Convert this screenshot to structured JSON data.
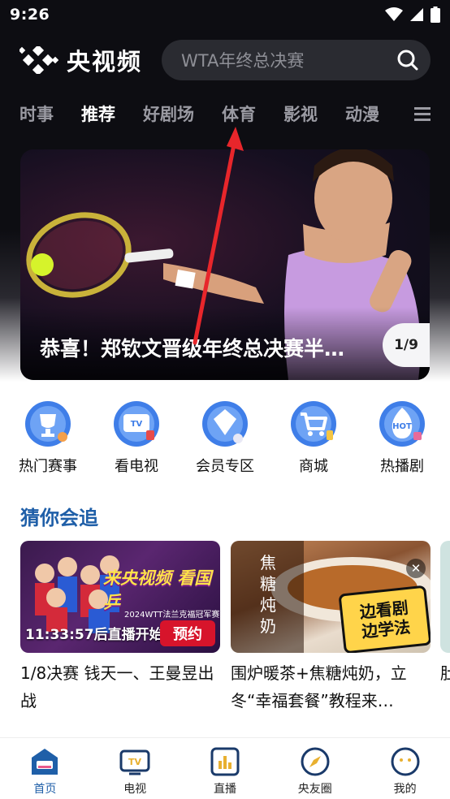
{
  "status_bar": {
    "time": "9:26"
  },
  "header": {
    "app_name": "央视频",
    "search_placeholder": "WTA年终总决赛"
  },
  "tabs": [
    {
      "label": "时事"
    },
    {
      "label": "推荐"
    },
    {
      "label": "好剧场"
    },
    {
      "label": "体育"
    },
    {
      "label": "影视"
    },
    {
      "label": "动漫"
    }
  ],
  "active_tab": "推荐",
  "banner": {
    "title": "恭喜！郑钦文晋级年终总决赛半…",
    "counter": "1/9"
  },
  "shortcuts": [
    {
      "label": "热门赛事",
      "icon": "trophy-icon"
    },
    {
      "label": "看电视",
      "icon": "tv-icon"
    },
    {
      "label": "会员专区",
      "icon": "vip-diamond-icon"
    },
    {
      "label": "商城",
      "icon": "cart-icon"
    },
    {
      "label": "热播剧",
      "icon": "hot-icon"
    }
  ],
  "section": {
    "title": "猜你会追"
  },
  "cards": [
    {
      "title": "1/8决赛 钱天一、王曼昱出战",
      "live_time": "11:33:57后直播开始",
      "button": "预约",
      "promo_title": "来央视频 看国乒",
      "promo_sub": "2024WTT法兰克福冠军赛"
    },
    {
      "title": "围炉暖茶+焦糖炖奶，立冬“幸福套餐”教程来…",
      "vertical_text": "焦糖炖奶",
      "sticker_line1": "边看剧",
      "sticker_line2": "边学法"
    }
  ],
  "peek_card": {
    "title": "肚个"
  },
  "bottom_nav": [
    {
      "label": "首页",
      "icon": "home-icon"
    },
    {
      "label": "电视",
      "icon": "tv-icon"
    },
    {
      "label": "直播",
      "icon": "live-chart-icon"
    },
    {
      "label": "央友圈",
      "icon": "compass-icon"
    },
    {
      "label": "我的",
      "icon": "profile-icon"
    }
  ],
  "colors": {
    "accent": "#1f5fa8",
    "dark_bg": "#0d0d12",
    "reserve_red": "#d7142b",
    "arrow_red": "#e8262b"
  }
}
